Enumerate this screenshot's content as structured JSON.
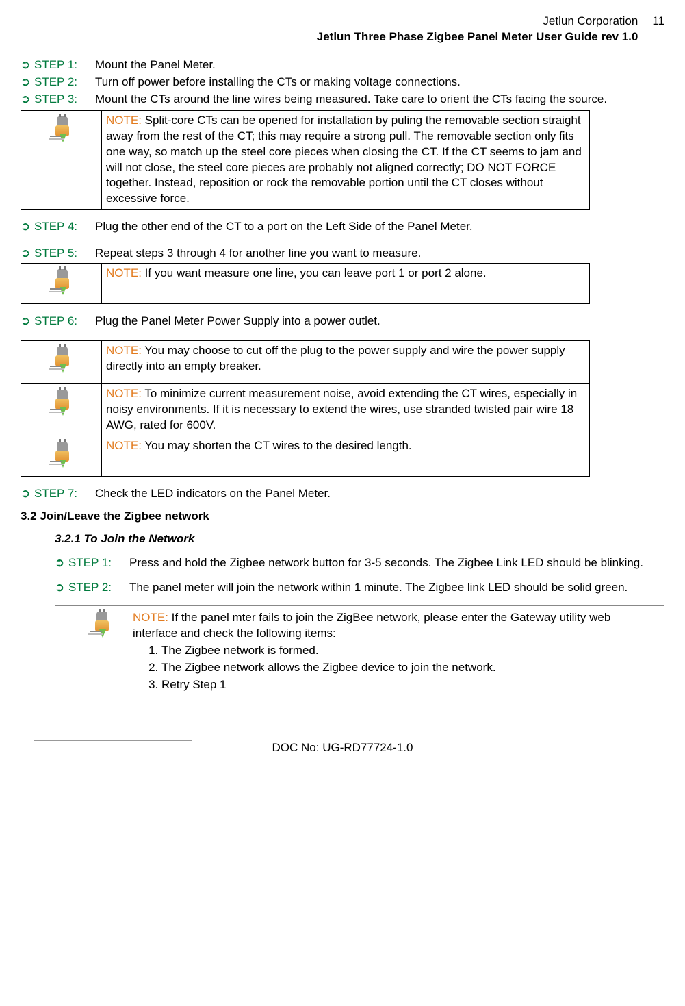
{
  "header": {
    "company": "Jetlun Corporation",
    "title": "Jetlun Three Phase Zigbee Panel Meter User Guide rev 1.0",
    "page": "11"
  },
  "steps_a": [
    {
      "label": "STEP 1:",
      "text": "Mount the Panel Meter."
    },
    {
      "label": "STEP 2:",
      "text": "Turn off power before installing the CTs or making voltage connections."
    },
    {
      "label": "STEP 3:",
      "text": "Mount the CTs around the line wires being measured. Take care to orient the CTs facing the source."
    }
  ],
  "note1": {
    "label": "NOTE:",
    "text": " Split-core CTs can be opened for installation by puling the removable section straight away from the rest of the CT; this may require a strong pull. The removable section only fits one way, so match up the steel core pieces when closing the CT. If the CT seems to jam and will not close, the steel core pieces are probably not aligned correctly; DO NOT FORCE together. Instead, reposition or rock the removable portion until the CT closes without excessive force."
  },
  "step4": {
    "label": "STEP 4:",
    "text": "Plug the other end of the CT to a port on the Left Side of the Panel Meter."
  },
  "step5": {
    "label": "STEP 5:",
    "text": "Repeat steps 3 through 4 for another line you want to measure."
  },
  "note2": {
    "label": "NOTE:",
    "text": " If you want measure one line, you can leave port 1 or port 2 alone."
  },
  "step6": {
    "label": "STEP 6:",
    "text": "Plug the Panel Meter Power Supply into a power outlet."
  },
  "note3": {
    "label": "NOTE:",
    "text": " You may choose to cut off the plug to the power supply and wire the power supply directly into an empty breaker."
  },
  "note4": {
    "label": "NOTE:",
    "text": " To minimize current measurement noise, avoid extending the CT wires, especially in noisy environments. If it is necessary to extend the wires, use stranded twisted pair wire 18 AWG, rated for 600V."
  },
  "note5": {
    "label": "NOTE:",
    "text": " You may shorten the CT wires to the desired length."
  },
  "step7": {
    "label": "STEP 7:",
    "text": "Check the LED indicators on the Panel Meter."
  },
  "section": "3.2 Join/Leave the Zigbee network",
  "subsection": "3.2.1 To Join the Network",
  "join_steps": [
    {
      "label": "STEP 1:",
      "text": "Press and hold the Zigbee network button for 3-5 seconds. The Zigbee Link LED should be blinking."
    },
    {
      "label": "STEP 2:",
      "text": "The panel meter will join the network within 1 minute. The Zigbee link LED should be solid green."
    }
  ],
  "bottom_note": {
    "label": "NOTE:",
    "intro": "  If the panel mter fails to join the ZigBee network, please enter the Gateway utility web interface and check the following items:",
    "items": [
      "The Zigbee network is formed.",
      "The Zigbee network allows the Zigbee device to join the network.",
      "Retry Step 1"
    ]
  },
  "footer": "DOC No: UG-RD77724-1.0"
}
